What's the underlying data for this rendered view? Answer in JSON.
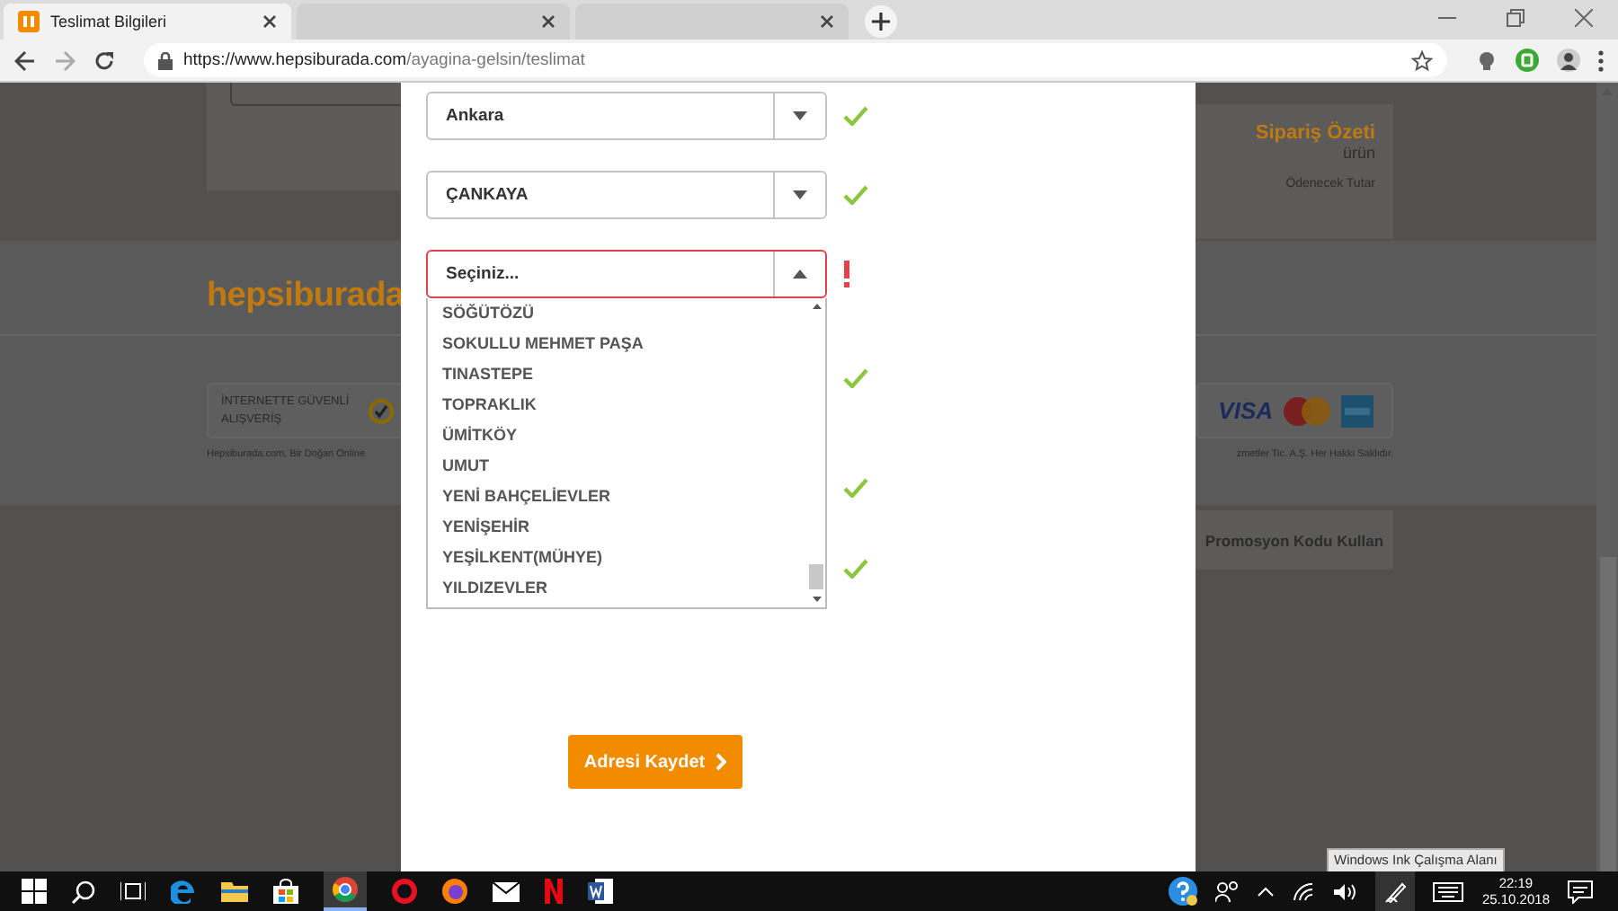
{
  "browser": {
    "tabs": [
      {
        "title": "Teslimat Bilgileri",
        "selected": true
      },
      {
        "selected": false
      },
      {
        "selected": false
      }
    ],
    "url_host": "https://www.hepsiburada.com",
    "url_path": "/ayagina-gelsin/teslimat"
  },
  "background_page": {
    "order_summary": {
      "title": "Sipariş Özeti",
      "items": "ürün",
      "total_label": "Ödenecek Tutar"
    },
    "logo": "hepsiburada",
    "secure_badge": "İNTERNETTE GÜVENLİ ALIŞVERİŞ",
    "visa": "VISA",
    "footer_left": "Hepsiburada.com, Bir Doğan Online",
    "footer_right": "zmetler Tic. A.Ş. Her Hakkı Saklıdır.",
    "promo_button": "Promosyon Kodu Kullan"
  },
  "modal": {
    "fields": [
      {
        "value": "Ankara",
        "valid": true,
        "open": false
      },
      {
        "value": "ÇANKAYA",
        "valid": true,
        "open": false
      },
      {
        "value": "Seçiniz...",
        "valid": false,
        "open": true
      },
      {
        "valid": true
      },
      {
        "valid": true
      },
      {
        "valid": true
      }
    ],
    "options": [
      "SÖĞÜTÖZÜ",
      "SOKULLU MEHMET PAŞA",
      "TINASTEPE",
      "TOPRAKLIK",
      "ÜMİTKÖY",
      "UMUT",
      "YENİ BAHÇELİEVLER",
      "YENİŞEHİR",
      "YEŞİLKENT(MÜHYE)",
      "YILDIZEVLER"
    ],
    "save_button": "Adresi Kaydet"
  },
  "tooltip": "Windows Ink Çalışma Alanı",
  "taskbar": {
    "time": "22:19",
    "date": "25.10.2018"
  }
}
